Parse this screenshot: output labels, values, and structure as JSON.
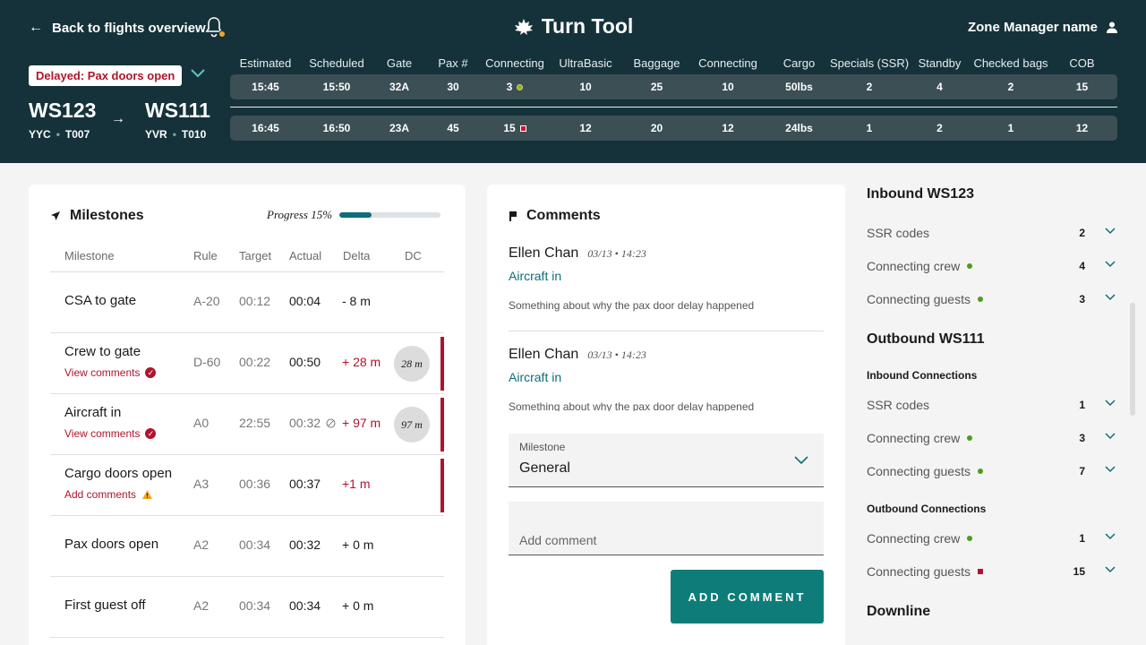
{
  "header": {
    "back_label": "Back to flights overview",
    "app_title": "Turn Tool",
    "user_name": "Zone Manager name",
    "status": "Delayed: Pax doors open",
    "inbound": {
      "flight": "WS123",
      "airport": "YYC",
      "terminal": "T007"
    },
    "outbound": {
      "flight": "WS111",
      "airport": "YVR",
      "terminal": "T010"
    },
    "columns": [
      "Estimated",
      "Scheduled",
      "Gate",
      "Pax #",
      "Connecting",
      "UltraBasic",
      "Baggage",
      "Connecting",
      "Cargo",
      "Specials (SSR)",
      "Standby",
      "Checked bags",
      "COB"
    ],
    "rows": [
      [
        "15:45",
        "15:50",
        "32A",
        "30",
        "3",
        "10",
        "25",
        "10",
        "50lbs",
        "2",
        "4",
        "2",
        "15"
      ],
      [
        "16:45",
        "16:50",
        "23A",
        "45",
        "15",
        "12",
        "20",
        "12",
        "24lbs",
        "1",
        "2",
        "1",
        "12"
      ]
    ]
  },
  "milestones": {
    "title": "Milestones",
    "progress_label": "Progress 15%",
    "progress_value": 0.32,
    "columns": {
      "milestone": "Milestone",
      "rule": "Rule",
      "target": "Target",
      "actual": "Actual",
      "delta": "Delta",
      "dc": "DC"
    },
    "items": [
      {
        "name": "CSA to gate",
        "link": "",
        "rule": "A-20",
        "target": "00:12",
        "actual": "00:04",
        "delta": "- 8 m",
        "dc": ""
      },
      {
        "name": "Crew to gate",
        "link": "View comments",
        "rule": "D-60",
        "target": "00:22",
        "actual": "00:50",
        "delta": "+ 28 m",
        "dc": "28 m"
      },
      {
        "name": "Aircraft in",
        "link": "View comments",
        "rule": "A0",
        "target": "22:55",
        "actual": "00:32",
        "delta": "+ 97 m",
        "dc": "97 m"
      },
      {
        "name": "Cargo doors open",
        "link": "Add comments",
        "rule": "A3",
        "target": "00:36",
        "actual": "00:37",
        "delta": "+1 m",
        "dc": ""
      },
      {
        "name": "Pax doors open",
        "link": "",
        "rule": "A2",
        "target": "00:34",
        "actual": "00:32",
        "delta": "+ 0 m",
        "dc": ""
      },
      {
        "name": "First guest off",
        "link": "",
        "rule": "A2",
        "target": "00:34",
        "actual": "00:34",
        "delta": "+ 0 m",
        "dc": ""
      }
    ]
  },
  "comments": {
    "title": "Comments",
    "items": [
      {
        "author": "Ellen Chan",
        "when": "03/13 • 14:23",
        "tag": "Aircraft in",
        "body": "Something about why the pax door delay happened"
      },
      {
        "author": "Ellen Chan",
        "when": "03/13 • 14:23",
        "tag": "Aircraft in",
        "body": "Something about why the pax door delay happened"
      }
    ],
    "select_label": "Milestone",
    "select_value": "General",
    "input_placeholder": "Add comment",
    "button_label": "ADD COMMENT"
  },
  "panel": {
    "inbound_title": "Inbound WS123",
    "inbound_rows": [
      {
        "label": "SSR codes",
        "count": "2"
      },
      {
        "label": "Connecting crew",
        "count": "4"
      },
      {
        "label": "Connecting guests",
        "count": "3"
      }
    ],
    "outbound_title": "Outbound WS111",
    "inbound_conn_title": "Inbound Connections",
    "inbound_conn_rows": [
      {
        "label": "SSR codes",
        "count": "1"
      },
      {
        "label": "Connecting crew",
        "count": "3"
      },
      {
        "label": "Connecting guests",
        "count": "7"
      }
    ],
    "outbound_conn_title": "Outbound Connections",
    "outbound_conn_rows": [
      {
        "label": "Connecting crew",
        "count": "1"
      },
      {
        "label": "Connecting guests",
        "count": "15"
      }
    ],
    "downline_title": "Downline"
  },
  "colors": {
    "header_bg": "#15323a",
    "accent": "#0e7d7a",
    "alert": "#b0142c",
    "ok": "#4a9d1e"
  }
}
